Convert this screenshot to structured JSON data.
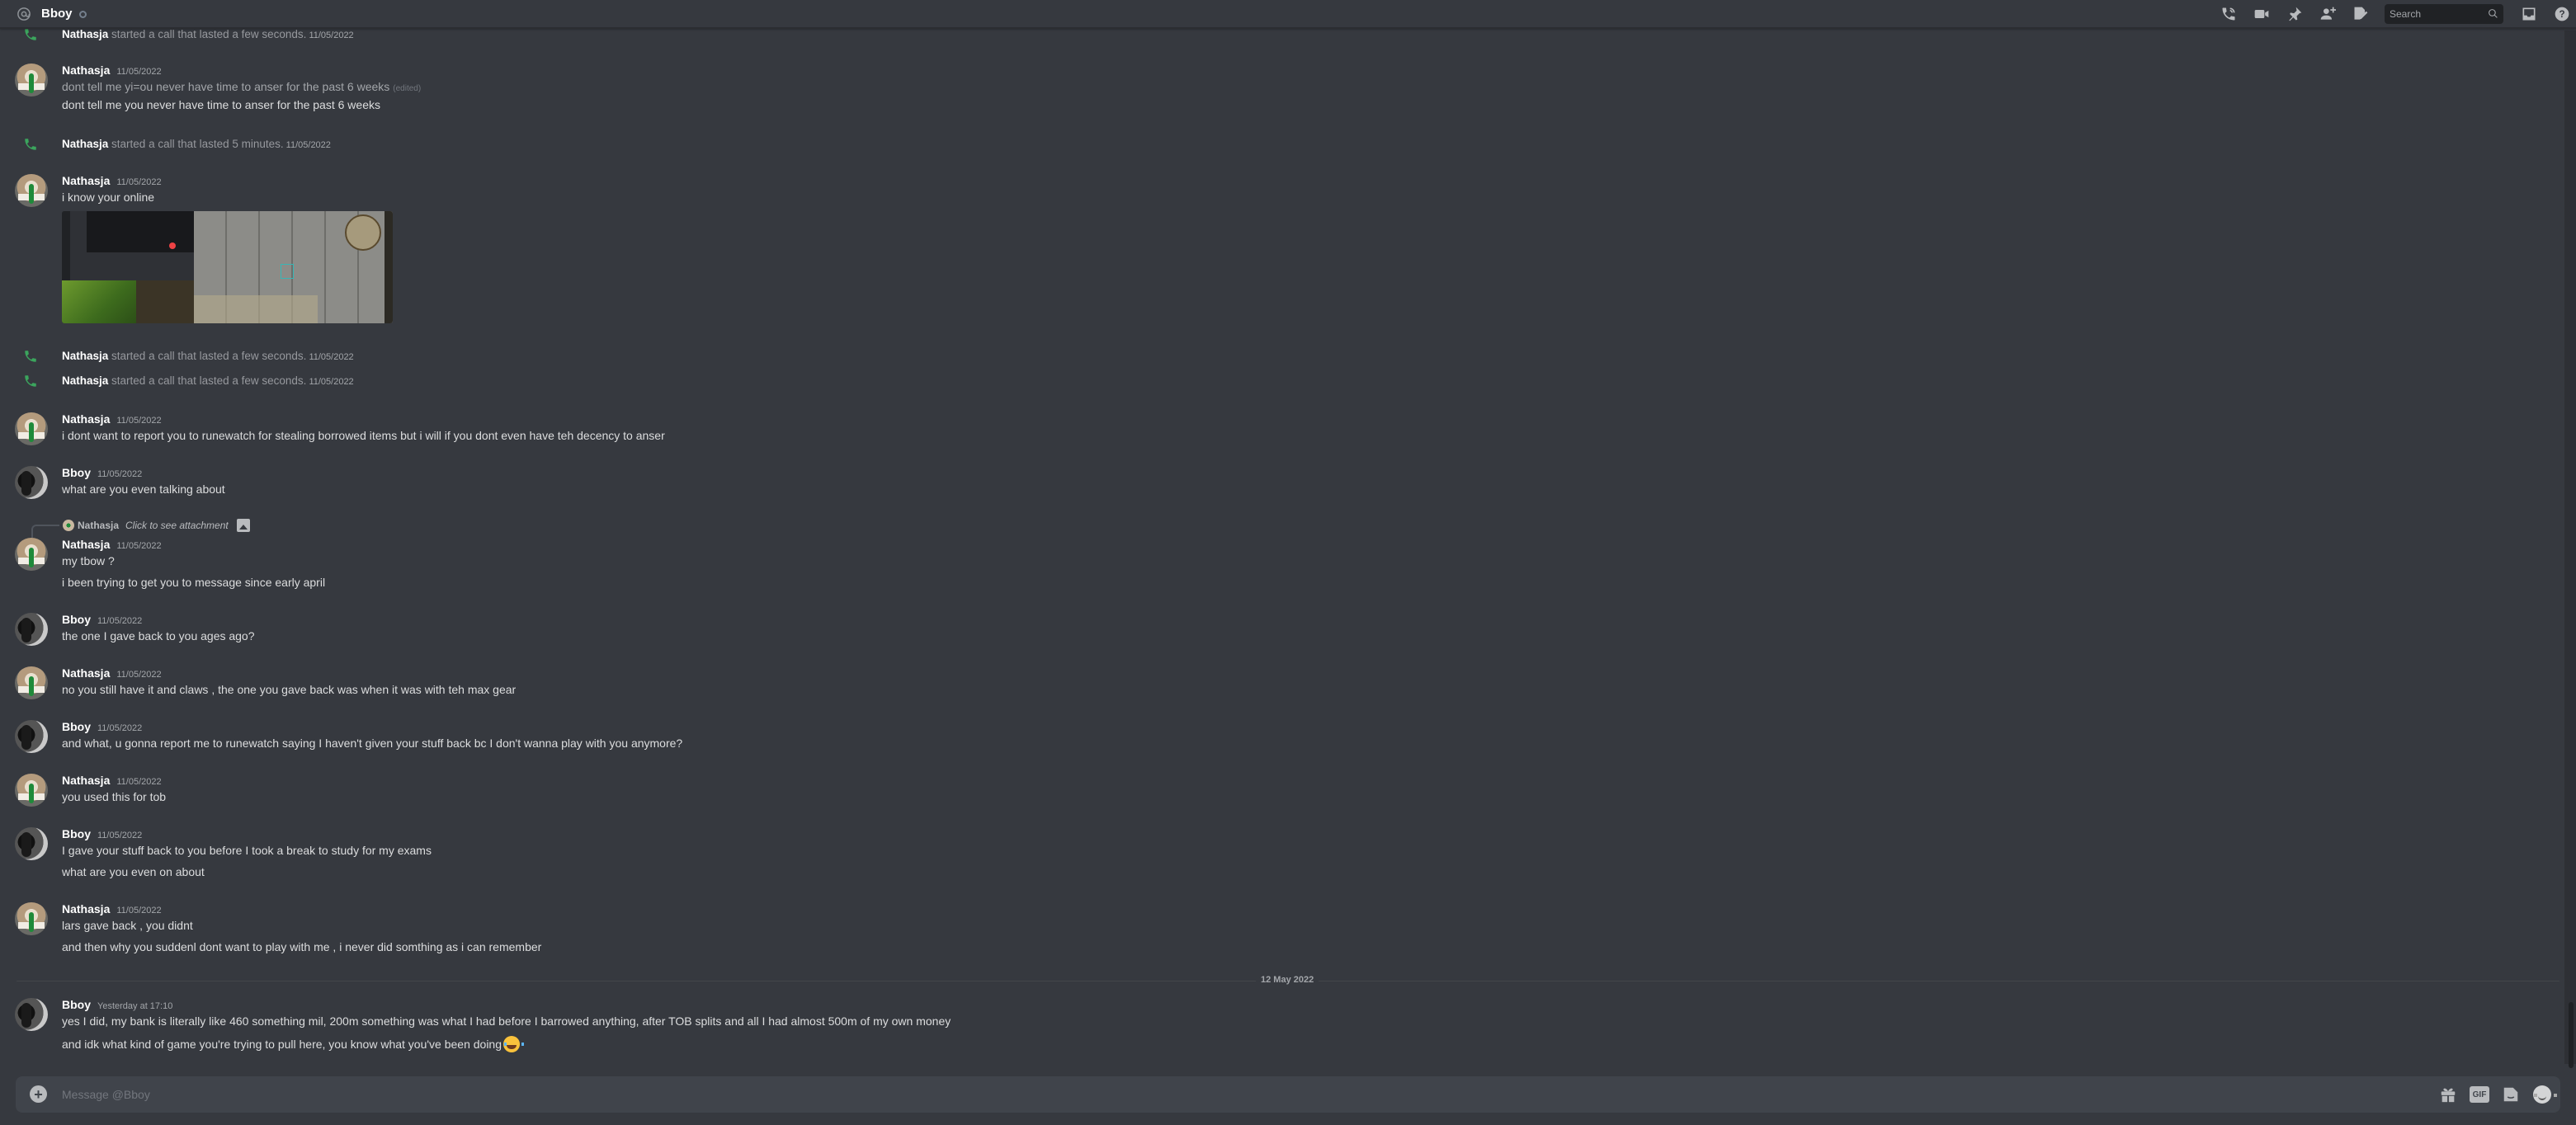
{
  "header": {
    "channel_icon": "at-sign-icon",
    "title": "Bboy",
    "status": "offline",
    "search_placeholder": "Search",
    "tool_icons": [
      "voice-call-icon",
      "video-call-icon",
      "pinned-messages-icon",
      "add-friends-icon",
      "notes-icon",
      "inbox-icon",
      "help-icon"
    ]
  },
  "messages": [
    {
      "type": "call",
      "author": "Nathasja",
      "text": "started a call that lasted a few seconds.",
      "timestamp": "11/05/2022"
    },
    {
      "type": "message",
      "author": "Nathasja",
      "avatar": "nathasja",
      "timestamp": "11/05/2022",
      "lines": [
        {
          "text": "dont tell me yi=ou never have time to anser for the past 6 weeks",
          "edited": "(edited)"
        },
        {
          "text": "dont tell me you never have time to anser for the past 6 weeks"
        }
      ]
    },
    {
      "type": "call",
      "author": "Nathasja",
      "text": "started a call that lasted 5 minutes.",
      "timestamp": "11/05/2022"
    },
    {
      "type": "message",
      "author": "Nathasja",
      "avatar": "nathasja",
      "timestamp": "11/05/2022",
      "lines": [
        {
          "text": "i know your online"
        }
      ],
      "attachment": "screenshot-image"
    },
    {
      "type": "call",
      "author": "Nathasja",
      "text": "started a call that lasted a few seconds.",
      "timestamp": "11/05/2022"
    },
    {
      "type": "call",
      "author": "Nathasja",
      "text": "started a call that lasted a few seconds.",
      "timestamp": "11/05/2022"
    },
    {
      "type": "message",
      "author": "Nathasja",
      "avatar": "nathasja",
      "timestamp": "11/05/2022",
      "lines": [
        {
          "text": "i dont want to report you to runewatch for stealing borrowed items but i will if you dont even have teh decency to anser"
        }
      ]
    },
    {
      "type": "message",
      "author": "Bboy",
      "avatar": "bboy",
      "timestamp": "11/05/2022",
      "lines": [
        {
          "text": "what are you even talking about"
        }
      ]
    },
    {
      "type": "message",
      "author": "Nathasja",
      "avatar": "nathasja",
      "timestamp": "11/05/2022",
      "reply": {
        "author": "Nathasja",
        "text": "Click to see attachment",
        "icon": "image-icon"
      },
      "lines": [
        {
          "text": "my tbow ?"
        },
        {
          "text": "i been trying to get you to message since early april"
        }
      ]
    },
    {
      "type": "message",
      "author": "Bboy",
      "avatar": "bboy",
      "timestamp": "11/05/2022",
      "lines": [
        {
          "text": "the one I gave back to you ages ago?"
        }
      ]
    },
    {
      "type": "message",
      "author": "Nathasja",
      "avatar": "nathasja",
      "timestamp": "11/05/2022",
      "lines": [
        {
          "text": "no you still have it and claws , the one you gave back was when it was with teh max gear"
        }
      ]
    },
    {
      "type": "message",
      "author": "Bboy",
      "avatar": "bboy",
      "timestamp": "11/05/2022",
      "lines": [
        {
          "text": "and what, u gonna report me to runewatch saying I haven't given your stuff back bc I don't wanna play with you anymore?"
        }
      ]
    },
    {
      "type": "message",
      "author": "Nathasja",
      "avatar": "nathasja",
      "timestamp": "11/05/2022",
      "lines": [
        {
          "text": "you used this for tob"
        }
      ]
    },
    {
      "type": "message",
      "author": "Bboy",
      "avatar": "bboy",
      "timestamp": "11/05/2022",
      "lines": [
        {
          "text": "I gave your stuff back to you before I took a break to study for my exams"
        },
        {
          "text": "what are you even on about"
        }
      ]
    },
    {
      "type": "message",
      "author": "Nathasja",
      "avatar": "nathasja",
      "timestamp": "11/05/2022",
      "lines": [
        {
          "text": "lars gave back , you didnt"
        },
        {
          "text": "and then why you suddenl dont want to play with me , i never did somthing as i can remember"
        }
      ]
    },
    {
      "type": "divider",
      "label": "12 May 2022"
    },
    {
      "type": "message",
      "author": "Bboy",
      "avatar": "bboy",
      "timestamp": "Yesterday at 17:10",
      "lines": [
        {
          "text": "yes I did, my bank is literally like 460 something mil, 200m something was what I had before I barrowed anything, after TOB splits and all I had almost 500m of my own money"
        },
        {
          "text": "and idk what kind of game you're trying to pull here, you know what you've been doing",
          "emoji": "joy-emoji"
        }
      ]
    }
  ],
  "composer": {
    "placeholder": "Message @Bboy",
    "value": "",
    "icons": [
      "upload-icon",
      "gift-icon",
      "gif-button",
      "sticker-icon",
      "emoji-icon"
    ],
    "gif_label": "GIF"
  }
}
